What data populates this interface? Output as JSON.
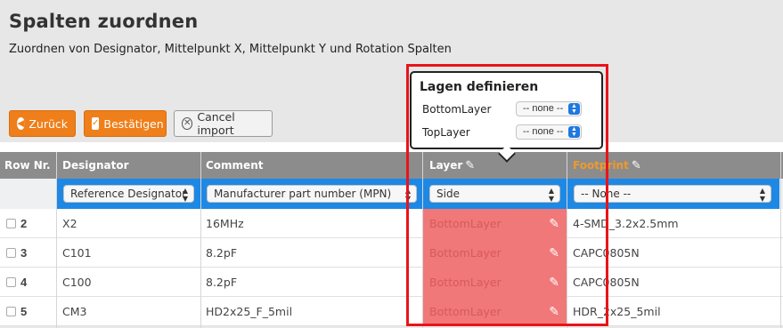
{
  "header": {
    "title": "Spalten zuordnen",
    "subtitle": "Zuordnen von Designator, Mittelpunkt X, Mittelpunkt Y und Rotation Spalten"
  },
  "toolbar": {
    "back_label": "Zurück",
    "confirm_label": "Bestätigen",
    "cancel_label": "Cancel import"
  },
  "popup": {
    "title": "Lagen definieren",
    "rows": [
      {
        "label": "BottomLayer",
        "value": "-- none --"
      },
      {
        "label": "TopLayer",
        "value": "-- none --"
      }
    ]
  },
  "table": {
    "columns": [
      "Row Nr.",
      "Designator",
      "Comment",
      "Layer",
      "Footprint"
    ],
    "selects": {
      "designator": "Reference Designator",
      "comment": "Manufacturer part number (MPN)",
      "layer": "Side",
      "footprint": "-- None --"
    },
    "rows": [
      {
        "num": "2",
        "designator": "X2",
        "comment": "16MHz",
        "layer": "BottomLayer",
        "footprint": "4-SMD_3.2x2.5mm"
      },
      {
        "num": "3",
        "designator": "C101",
        "comment": "8.2pF",
        "layer": "BottomLayer",
        "footprint": "CAPC0805N"
      },
      {
        "num": "4",
        "designator": "C100",
        "comment": "8.2pF",
        "layer": "BottomLayer",
        "footprint": "CAPC0805N"
      },
      {
        "num": "5",
        "designator": "CM3",
        "comment": "HD2x25_F_5mil",
        "layer": "BottomLayer",
        "footprint": "HDR_2x25_5mil"
      }
    ]
  },
  "colors": {
    "accent": "#ef7f1a",
    "select_blue": "#1e88e5",
    "layer_highlight": "#f07878",
    "annotation_red": "#e8141b"
  }
}
